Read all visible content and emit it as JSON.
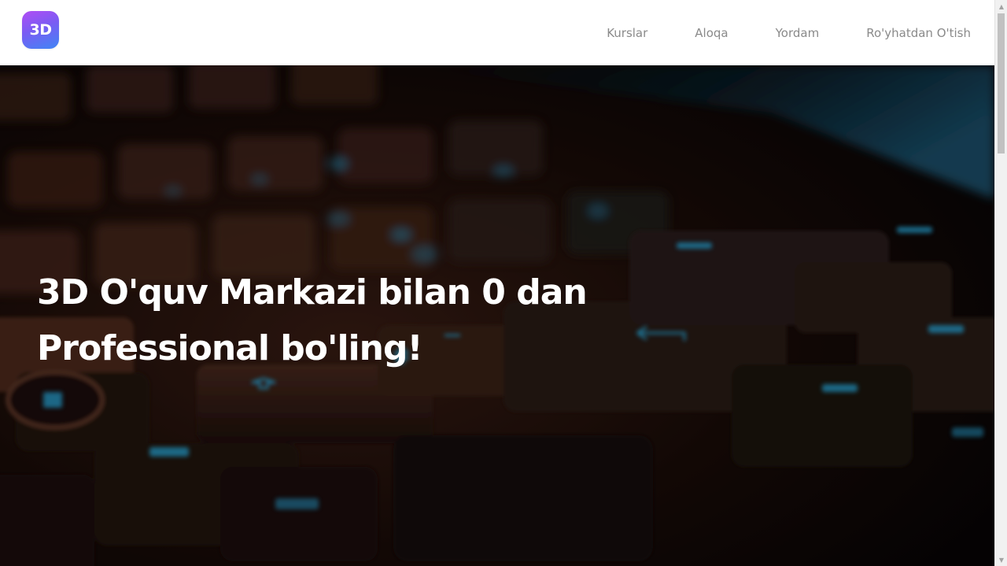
{
  "logo": {
    "text": "3D"
  },
  "nav": {
    "items": [
      {
        "label": "Kurslar"
      },
      {
        "label": "Aloqa"
      },
      {
        "label": "Yordam"
      },
      {
        "label": "Ro'yhatdan O'tish"
      }
    ]
  },
  "hero": {
    "title_line1": "3D O'quv Markazi bilan 0 dan",
    "title_line2": "Professional bo'ling!"
  },
  "colors": {
    "accent_gradient_start": "#b14cf4",
    "accent_gradient_end": "#3f86f5",
    "nav_text": "#8a8a8a",
    "hero_text": "#ffffff",
    "key_glow": "#2aa7d9"
  },
  "icons": {
    "scroll_up": "triangle-up",
    "scroll_down": "triangle-down"
  }
}
